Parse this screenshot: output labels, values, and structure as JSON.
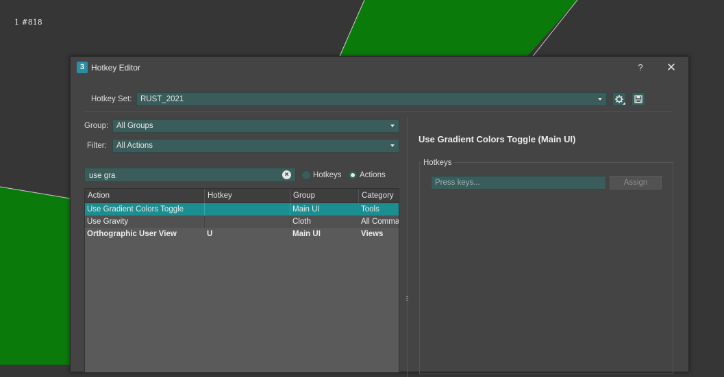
{
  "viewport": {
    "corner_label": "1 #818"
  },
  "dialog": {
    "title": "Hotkey Editor",
    "app_icon_text": "3",
    "help_label": "?",
    "close_label": "✕"
  },
  "hotkey_set": {
    "label": "Hotkey Set:",
    "value": "RUST_2021",
    "settings_icon": "gear-icon",
    "save_icon": "floppy-disk-icon"
  },
  "left": {
    "group_label": "Group:",
    "group_value": "All Groups",
    "filter_label": "Filter:",
    "filter_value": "All Actions",
    "search_value": "use gra",
    "radio_hotkeys": "Hotkeys",
    "radio_actions": "Actions",
    "radio_selected": "Actions",
    "columns": [
      "Action",
      "Hotkey",
      "Group",
      "Category"
    ],
    "rows": [
      {
        "action": "Use Gradient Colors Toggle",
        "hotkey": "",
        "group": "Main UI",
        "category": "Tools",
        "selected": true,
        "bold": false
      },
      {
        "action": "Use Gravity",
        "hotkey": "",
        "group": "Cloth",
        "category": "All Comma...",
        "selected": false,
        "bold": false
      },
      {
        "action": "Orthographic User View",
        "hotkey": "U",
        "group": "Main UI",
        "category": "Views",
        "selected": false,
        "bold": true
      }
    ]
  },
  "right": {
    "title": "Use Gradient Colors Toggle (Main UI)",
    "hotkeys_group_label": "Hotkeys",
    "press_keys_placeholder": "Press keys...",
    "assign_label": "Assign"
  },
  "colors": {
    "accent_field": "#3a5c5a",
    "selection": "#1a8e90",
    "viewport_green": "#0a7a0a"
  }
}
